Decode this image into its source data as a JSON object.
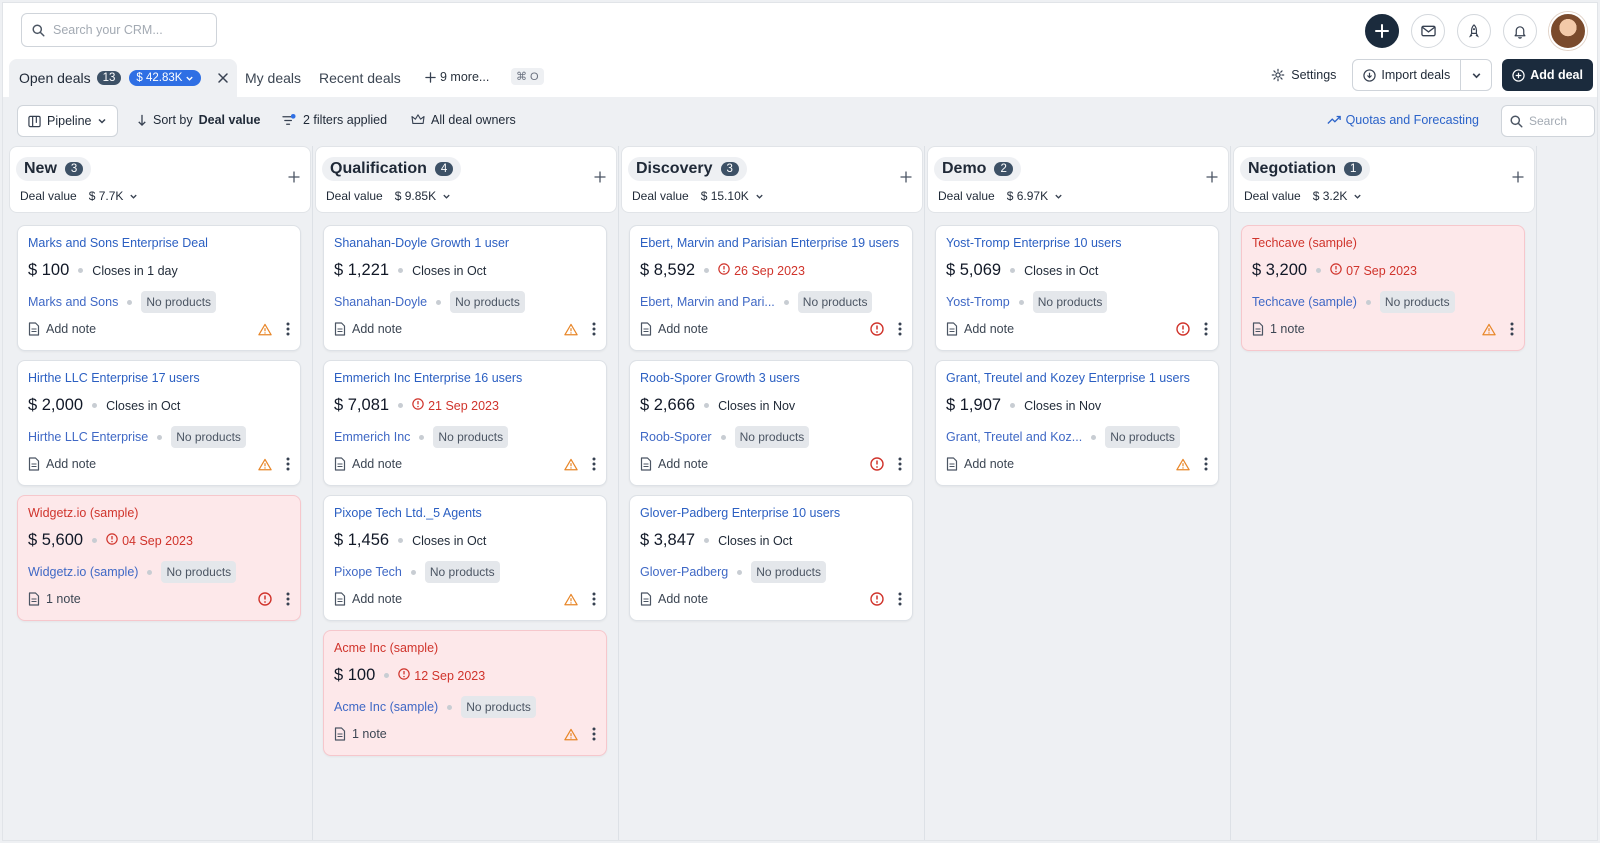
{
  "search": {
    "placeholder": "Search your CRM..."
  },
  "tabs": {
    "active": {
      "label": "Open deals",
      "count": "13",
      "value": "$ 42.83K"
    },
    "my_deals": "My deals",
    "recent_deals": "Recent deals",
    "more": "9 more...",
    "shortcut": "⌘ O"
  },
  "actions": {
    "settings": "Settings",
    "import": "Import deals",
    "add_deal": "Add deal"
  },
  "filters": {
    "pipeline": "Pipeline",
    "sort_prefix": "Sort by",
    "sort_value": "Deal value",
    "filters_applied": "2 filters applied",
    "owners": "All deal owners",
    "quotas": "Quotas and Forecasting",
    "search_placeholder": "Search"
  },
  "colors": {
    "accent": "#2f6fe4",
    "dark": "#1b2b3d",
    "overdue_bg": "#fde8ea",
    "danger": "#d0342c",
    "warning": "#e8872a"
  },
  "columns": [
    {
      "name": "New",
      "count": "3",
      "value_label": "Deal value",
      "value": "$ 7.7K",
      "cards": [
        {
          "title": "Marks and Sons Enterprise Deal",
          "price": "$ 100",
          "closes": "Closes in 1 day",
          "late": false,
          "org": "Marks and Sons",
          "products": "No products",
          "note": "Add note",
          "flag": "warning-icon"
        },
        {
          "title": "Hirthe LLC Enterprise 17 users",
          "price": "$ 2,000",
          "closes": "Closes in Oct",
          "late": false,
          "org": "Hirthe LLC Enterprise",
          "products": "No products",
          "note": "Add note",
          "flag": "warning-icon"
        },
        {
          "title": "Widgetz.io (sample)",
          "price": "$ 5,600",
          "closes": "04 Sep 2023",
          "late": true,
          "org": "Widgetz.io (sample)",
          "products": "No products",
          "note": "1 note",
          "flag": "alert-icon"
        }
      ]
    },
    {
      "name": "Qualification",
      "count": "4",
      "value_label": "Deal value",
      "value": "$ 9.85K",
      "cards": [
        {
          "title": "Shanahan-Doyle Growth 1 user",
          "price": "$ 1,221",
          "closes": "Closes in Oct",
          "late": false,
          "org": "Shanahan-Doyle",
          "products": "No products",
          "note": "Add note",
          "flag": "warning-icon"
        },
        {
          "title": "Emmerich Inc Enterprise 16 users",
          "price": "$ 7,081",
          "closes": "21 Sep 2023",
          "late": true,
          "org": "Emmerich Inc",
          "products": "No products",
          "note": "Add note",
          "flag": "warning-icon"
        },
        {
          "title": "Pixope Tech Ltd._5 Agents",
          "price": "$ 1,456",
          "closes": "Closes in Oct",
          "late": false,
          "org": "Pixope Tech",
          "products": "No products",
          "note": "Add note",
          "flag": "warning-icon"
        },
        {
          "title": "Acme Inc (sample)",
          "price": "$ 100",
          "closes": "12 Sep 2023",
          "late": true,
          "org": "Acme Inc (sample)",
          "products": "No products",
          "note": "1 note",
          "flag": "warning-icon"
        }
      ]
    },
    {
      "name": "Discovery",
      "count": "3",
      "value_label": "Deal value",
      "value": "$ 15.10K",
      "cards": [
        {
          "title": "Ebert, Marvin and Parisian Enterprise 19 users",
          "price": "$ 8,592",
          "closes": "26 Sep 2023",
          "late": true,
          "org": "Ebert, Marvin and Pari...",
          "products": "No products",
          "note": "Add note",
          "flag": "alert-icon"
        },
        {
          "title": "Roob-Sporer Growth 3 users",
          "price": "$ 2,666",
          "closes": "Closes in Nov",
          "late": false,
          "org": "Roob-Sporer",
          "products": "No products",
          "note": "Add note",
          "flag": "alert-icon"
        },
        {
          "title": "Glover-Padberg Enterprise 10 users",
          "price": "$ 3,847",
          "closes": "Closes in Oct",
          "late": false,
          "org": "Glover-Padberg",
          "products": "No products",
          "note": "Add note",
          "flag": "alert-icon"
        }
      ]
    },
    {
      "name": "Demo",
      "count": "2",
      "value_label": "Deal value",
      "value": "$ 6.97K",
      "cards": [
        {
          "title": "Yost-Tromp Enterprise 10 users",
          "price": "$ 5,069",
          "closes": "Closes in Oct",
          "late": false,
          "org": "Yost-Tromp",
          "products": "No products",
          "note": "Add note",
          "flag": "alert-icon"
        },
        {
          "title": "Grant, Treutel and Kozey Enterprise 1 users",
          "price": "$ 1,907",
          "closes": "Closes in Nov",
          "late": false,
          "org": "Grant, Treutel and Koz...",
          "products": "No products",
          "note": "Add note",
          "flag": "warning-icon"
        }
      ]
    },
    {
      "name": "Negotiation",
      "count": "1",
      "value_label": "Deal value",
      "value": "$ 3.2K",
      "cards": [
        {
          "title": "Techcave (sample)",
          "price": "$ 3,200",
          "closes": "07 Sep 2023",
          "late": true,
          "org": "Techcave (sample)",
          "products": "No products",
          "note": "1 note",
          "flag": "warning-icon"
        }
      ]
    }
  ]
}
